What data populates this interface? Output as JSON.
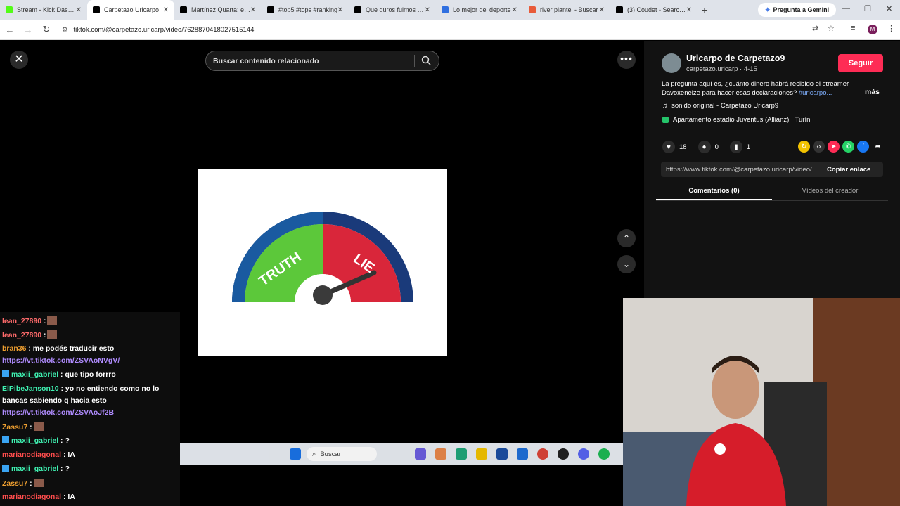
{
  "browser": {
    "tabs": [
      {
        "title": "Stream - Kick Dashboard",
        "color": "#53fc18"
      },
      {
        "title": "Carpetazo Uricarpo",
        "color": "#000000",
        "active": true
      },
      {
        "title": "Martínez Quarta: el vi...",
        "color": "#000000"
      },
      {
        "title": "#top5 #tops #ranking",
        "color": "#000000"
      },
      {
        "title": "Que duros fuimos mi...",
        "color": "#000000"
      },
      {
        "title": "Lo mejor del deporte",
        "color": "#2f6fe0"
      },
      {
        "title": "river plantel - Buscar",
        "color": "#e85b3a"
      },
      {
        "title": "(3) Coudet - Search / X",
        "color": "#000000"
      }
    ],
    "gemini_label": "Pregunta a Gemini",
    "url": "tiktok.com/@carpetazo.uricarp/video/7628870418027515144",
    "profile_initial": "M"
  },
  "viewer": {
    "search_placeholder": "Buscar contenido relacionado",
    "video_text_truth": "TRUTH",
    "video_text_lie": "LIE"
  },
  "panel": {
    "name": "Uricarpo de Carpetazo9",
    "handle": "carpetazo.uricarp · 4-15",
    "follow_label": "Seguir",
    "description": "La pregunta aquí es, ¿cuánto dinero habrá recibido el streamer Davoxeneize para hacer esas declaraciones?",
    "description_tag": "#uricarpo...",
    "more_label": "más",
    "music": "sonido original - Carpetazo Uricarp9",
    "location": "Apartamento estadio Juventus (Allianz) · Turín",
    "likes": "18",
    "comments": "0",
    "saves": "1",
    "link": "https://www.tiktok.com/@carpetazo.uricarp/video/...",
    "copy_label": "Copiar enlace",
    "tab_comments": "Comentarios (0)",
    "tab_videos": "Vídeos del creador"
  },
  "chat": [
    {
      "user": "lean_27890",
      "color": "#ff6b6b",
      "text": ":",
      "emote": true
    },
    {
      "user": "lean_27890",
      "color": "#ff6b6b",
      "text": ":",
      "emote": true
    },
    {
      "user": "bran36",
      "color": "#f0a030",
      "text": ": me podés traducir esto"
    },
    {
      "user": "",
      "color": "#b08cff",
      "link": "https://vt.tiktok.com/ZSVAoNVgV/"
    },
    {
      "user": "maxii_gabriel",
      "color": "#3ff2b2",
      "text": ": que tipo forrro",
      "badge": true
    },
    {
      "user": "ElPibeJanson10",
      "color": "#3ff2b2",
      "text": ": yo no entiendo como no lo"
    },
    {
      "user": "",
      "color": "#fff",
      "text": "bancas sabiendo q hacia esto"
    },
    {
      "user": "",
      "color": "#b08cff",
      "link": "https://vt.tiktok.com/ZSVAoJf2B"
    },
    {
      "user": "Zassu7",
      "color": "#f0a030",
      "text": ":",
      "emote": true
    },
    {
      "user": "maxii_gabriel",
      "color": "#3ff2b2",
      "text": ": ?",
      "badge": true
    },
    {
      "user": "marianodiagonal",
      "color": "#ff4d4d",
      "text": ": IA"
    },
    {
      "user": "maxii_gabriel",
      "color": "#3ff2b2",
      "text": ": ?",
      "badge": true
    },
    {
      "user": "Zassu7",
      "color": "#f0a030",
      "text": ":",
      "emote": true
    },
    {
      "user": "marianodiagonal",
      "color": "#ff4d4d",
      "text": ": IA"
    }
  ],
  "taskbar": {
    "search_label": "Buscar"
  }
}
